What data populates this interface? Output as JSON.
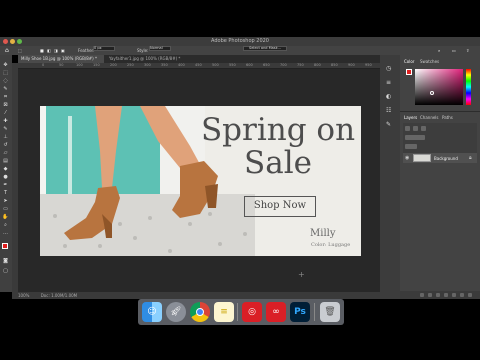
{
  "app": {
    "title": "Adobe Photoshop 2020"
  },
  "options_bar": {
    "feather_label": "Feather:",
    "feather_value": "0 px",
    "style_label": "Style:",
    "style_value": "Normal",
    "select_mask_label": "Select and Mask..."
  },
  "document_tabs": [
    {
      "label": "Milly Shoe 1B.jpg @ 100% (RGB/8#) *",
      "active": true
    },
    {
      "label": "Yayfaither1.jpg @ 100% (RGB/8#) *",
      "active": false
    }
  ],
  "ruler_ticks": [
    "0",
    "50",
    "100",
    "150",
    "200",
    "250",
    "300",
    "350",
    "400",
    "450",
    "500",
    "550",
    "600",
    "650",
    "700",
    "750",
    "800",
    "850",
    "900",
    "950"
  ],
  "canvas": {
    "headline_line1": "Spring on",
    "headline_line2": "Sale",
    "cta_label": "Shop Now",
    "brand": "Milly",
    "color_label": "Color: Luggage"
  },
  "status_bar": {
    "zoom": "100%",
    "doc_size": "Doc: 1.00M/1.00M"
  },
  "panels": {
    "color_tab": "Color",
    "swatches_tab": "Swatches",
    "layers_tab": "Layers",
    "channels_tab": "Channels",
    "paths_tab": "Paths",
    "background_layer": "Background"
  },
  "colors": {
    "accent": "#31a8ff",
    "teal": "#5dc1b4",
    "leather": "#b8743f"
  },
  "dock": {
    "apps": [
      "finder-icon",
      "launchpad-icon",
      "chrome-icon",
      "notes-icon",
      "adobe-icon",
      "creative-cloud-icon",
      "photoshop-icon",
      "trash-icon"
    ],
    "photoshop_label": "Ps"
  }
}
